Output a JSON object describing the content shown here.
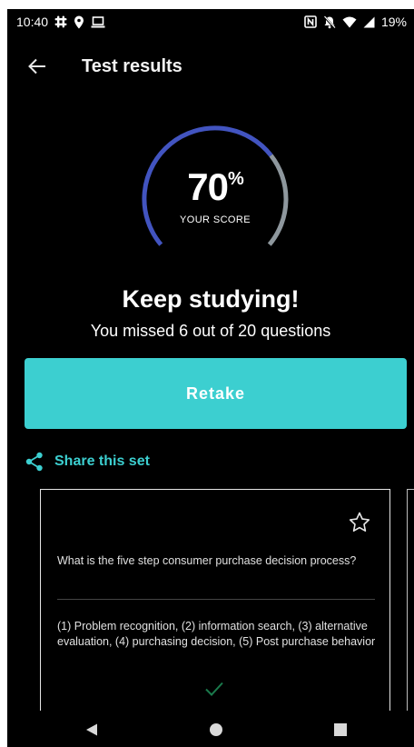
{
  "status_bar": {
    "time": "10:40",
    "battery_percent": "19%",
    "left_icons": [
      "slack-icon",
      "location-pin-icon",
      "laptop-icon"
    ],
    "right_icons": [
      "nfc-icon",
      "notifications-off-icon",
      "wifi-icon",
      "signal-icon"
    ]
  },
  "app_bar": {
    "title": "Test results",
    "back_icon": "arrow-left-icon"
  },
  "score": {
    "value": "70",
    "percent_sign": "%",
    "label": "YOUR SCORE",
    "fraction": 0.7,
    "colors": {
      "progress": "#4254c0",
      "remainder": "#8e979d"
    }
  },
  "result": {
    "headline": "Keep studying!",
    "subline": "You missed 6 out of 20 questions"
  },
  "actions": {
    "retake_label": "Retake",
    "share_label": "Share this set",
    "share_icon": "share-icon"
  },
  "card": {
    "question": "What is the five step consumer purchase decision process?",
    "answer": "(1) Problem recognition, (2) information search, (3) alternative evaluation, (4) purchasing decision, (5) Post purchase behavior",
    "star_icon": "star-outline-icon",
    "result_icon": "checkmark-icon",
    "result_color": "#1a7a4c"
  },
  "nav_bar": {
    "icons": [
      "back-triangle-icon",
      "home-circle-icon",
      "recents-square-icon"
    ]
  },
  "colors": {
    "accent": "#3ccfd0",
    "background": "#000000"
  }
}
